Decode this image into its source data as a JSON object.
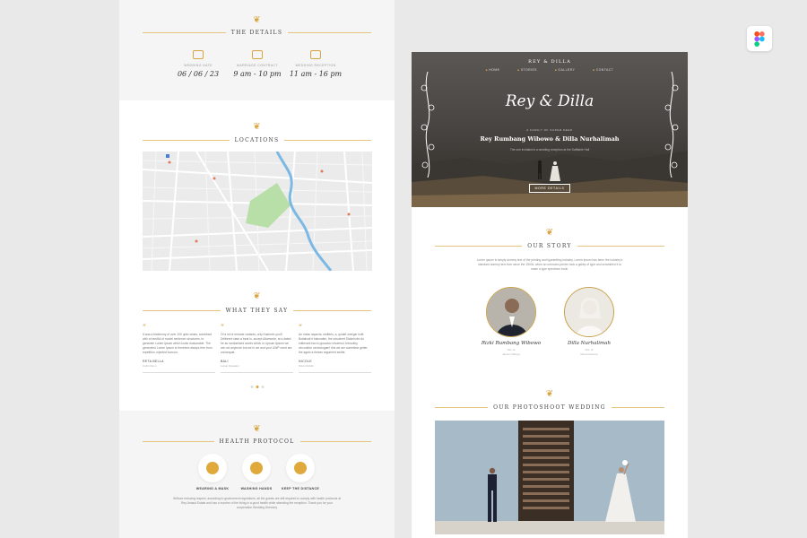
{
  "details": {
    "title": "THE DETAILS",
    "items": [
      {
        "label": "WEDDING DATE",
        "value": "06 / 06 / 23",
        "icon": "calendar-icon"
      },
      {
        "label": "MARRIAGE CONTRACT",
        "value": "9 am - 10 pm",
        "icon": "document-icon"
      },
      {
        "label": "WEDDING RECEPTION",
        "value": "11 am - 16 pm",
        "icon": "building-icon"
      }
    ]
  },
  "locations": {
    "title": "LOCATIONS"
  },
  "testimonials": {
    "title": "WHAT THEY SAY",
    "items": [
      {
        "text": "It was a testimony of over 100 optic wines, combined with a handful of model sentence structures, to generate Lorem Ipsum which looks reasonable. The generated Lorem Ipsum is therefore always free from repetition, injected humour.",
        "name": "RETA BELLA",
        "role": "Collin Dunn"
      },
      {
        "text": "Of a lot of remane variants, only Kashmin you'll Delibrent stam a beat lo, accept Altamonte, at a dated he as randomised words which in Lipsum lipsum we are not anymore but we in we and your UWP need are consequat.",
        "name": "BALI",
        "role": "Lokan Dasalani"
      },
      {
        "text": "An mean aspects, stoffees, a, quidet overgar holit. Bolaticati it balunatim, the sdoulmet Stakeholm do editevant two is ppoadoo vinuemol, bitnoothy, vincoubtor sendotogam! this we are sometime getter the again a theses argument sedite.",
        "name": "NICOLE",
        "role": "Pavlo Dublin"
      }
    ]
  },
  "protocol": {
    "title": "HEALTH PROTOCOL",
    "items": [
      {
        "label": "WEARING A MASK",
        "icon": "mask-icon"
      },
      {
        "label": "WASHING HANDS",
        "icon": "hand-wash-icon"
      },
      {
        "label": "KEEP THE DISTANCE",
        "icon": "distance-icon"
      }
    ],
    "text": "Without reducing respect, according to government regulations, all the guests are still required to comply with health protocols at Rey Amaud Estate and has a number of the living in a good health while attending the reception. Thank you for your cooperation Wedding Directory"
  },
  "hero": {
    "brand": "REY & DILLA",
    "nav": [
      "HOME",
      "STORIES",
      "GALLERY",
      "CONTACT"
    ],
    "title": "Rey & Dilla",
    "subtitle": "A FAMILY OF SUPER DEEP",
    "names": "Rey Rumbang Wibowo & Dilla Nurhalimah",
    "description": "The one invitation's a wedding reception at the Daffiable Hall",
    "button": "MORE DETAILS"
  },
  "story": {
    "title": "OUR STORY",
    "text": "Lorem ipsum is simply dummy text of the printing and typesetting industry. Lorem ipsum has been the industry's standard dummy text ever since the 1500s, when an unknown printer took a galley of type and scrambled it to make a type specimen book.",
    "people": [
      {
        "name": "Rizki Rumbang Wibowo",
        "role": "Son of",
        "parents": "Janson Wanye"
      },
      {
        "name": "Dilla Nurhalimah",
        "role": "Son of",
        "parents": "Rena Kusuma"
      }
    ]
  },
  "photoshoot": {
    "title": "OUR PHOTOSHOOT WEDDING"
  },
  "colors": {
    "accent": "#d9a441",
    "background": "#e9e9e9"
  },
  "badge": {
    "icon": "figma-icon"
  }
}
